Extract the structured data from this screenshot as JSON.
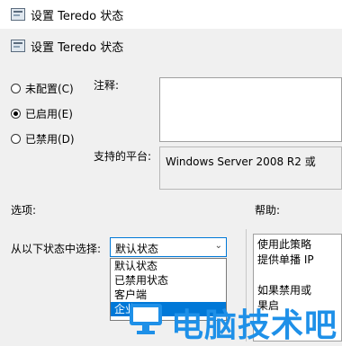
{
  "window": {
    "title": "设置 Teredo 状态"
  },
  "header": {
    "title": "设置 Teredo 状态"
  },
  "radios": [
    {
      "label": "未配置(C)",
      "checked": false
    },
    {
      "label": "已启用(E)",
      "checked": true
    },
    {
      "label": "已禁用(D)",
      "checked": false
    }
  ],
  "comment": {
    "label": "注释:",
    "value": ""
  },
  "platform": {
    "label": "支持的平台:",
    "value": "Windows Server 2008 R2 或"
  },
  "options": {
    "label": "选项:",
    "state_label": "从以下状态中选择:",
    "selected": "默认状态",
    "dropdown": [
      "默认状态",
      "已禁用状态",
      "客户端",
      "企业"
    ]
  },
  "help": {
    "label": "帮助:",
    "lines": [
      "使用此策略",
      "提供单播 IP",
      "",
      "如果禁用或",
      "果启"
    ]
  },
  "watermark": {
    "text": "电脑技术吧"
  }
}
